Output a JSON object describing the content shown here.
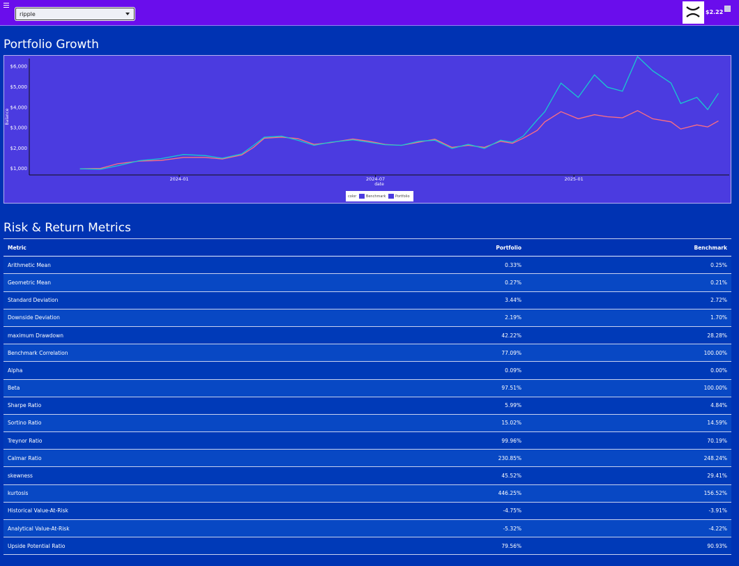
{
  "topbar": {
    "select_value": "ripple",
    "price": "$2.22",
    "colors": {
      "bar": "#6a0dec",
      "page": "#0033b3"
    }
  },
  "growth": {
    "title": "Portfolio Growth"
  },
  "chart_data": {
    "type": "line",
    "xlabel": "date",
    "ylabel": "Balance",
    "x_ticks": [
      "2024-01",
      "2024-07",
      "2025-01"
    ],
    "y_ticks": [
      "$1,000",
      "$2,000",
      "$3,000",
      "$4,000",
      "$5,000",
      "$6,000"
    ],
    "ylim": [
      700,
      6400
    ],
    "xlim": [
      "2023-08-15",
      "2025-05-25"
    ],
    "legend": {
      "title": "color",
      "position": "bottom-center"
    },
    "series": [
      {
        "name": "Benchmark",
        "color": "#ff6f7f",
        "points": [
          [
            "2023-10-01",
            1000
          ],
          [
            "2023-10-20",
            1020
          ],
          [
            "2023-11-05",
            1250
          ],
          [
            "2023-11-25",
            1380
          ],
          [
            "2023-12-15",
            1410
          ],
          [
            "2024-01-05",
            1560
          ],
          [
            "2024-01-25",
            1560
          ],
          [
            "2024-02-10",
            1480
          ],
          [
            "2024-02-28",
            1680
          ],
          [
            "2024-03-10",
            2050
          ],
          [
            "2024-03-20",
            2500
          ],
          [
            "2024-04-05",
            2550
          ],
          [
            "2024-04-20",
            2480
          ],
          [
            "2024-05-05",
            2200
          ],
          [
            "2024-05-20",
            2280
          ],
          [
            "2024-06-10",
            2460
          ],
          [
            "2024-06-25",
            2350
          ],
          [
            "2024-07-10",
            2200
          ],
          [
            "2024-07-25",
            2150
          ],
          [
            "2024-08-10",
            2300
          ],
          [
            "2024-08-25",
            2450
          ],
          [
            "2024-09-10",
            2050
          ],
          [
            "2024-09-25",
            2150
          ],
          [
            "2024-10-10",
            2050
          ],
          [
            "2024-10-25",
            2350
          ],
          [
            "2024-11-05",
            2250
          ],
          [
            "2024-11-15",
            2500
          ],
          [
            "2024-11-28",
            2880
          ],
          [
            "2024-12-05",
            3300
          ],
          [
            "2024-12-20",
            3800
          ],
          [
            "2025-01-05",
            3450
          ],
          [
            "2025-01-20",
            3650
          ],
          [
            "2025-02-01",
            3550
          ],
          [
            "2025-02-15",
            3500
          ],
          [
            "2025-03-01",
            3850
          ],
          [
            "2025-03-15",
            3450
          ],
          [
            "2025-04-01",
            3300
          ],
          [
            "2025-04-10",
            2950
          ],
          [
            "2025-04-25",
            3150
          ],
          [
            "2025-05-05",
            3050
          ],
          [
            "2025-05-15",
            3350
          ]
        ]
      },
      {
        "name": "Portfolio",
        "color": "#19c9cf",
        "points": [
          [
            "2023-10-01",
            1000
          ],
          [
            "2023-10-20",
            980
          ],
          [
            "2023-11-05",
            1150
          ],
          [
            "2023-11-25",
            1400
          ],
          [
            "2023-12-15",
            1500
          ],
          [
            "2024-01-05",
            1700
          ],
          [
            "2024-01-25",
            1650
          ],
          [
            "2024-02-10",
            1520
          ],
          [
            "2024-02-28",
            1730
          ],
          [
            "2024-03-10",
            2150
          ],
          [
            "2024-03-20",
            2550
          ],
          [
            "2024-04-05",
            2600
          ],
          [
            "2024-04-20",
            2400
          ],
          [
            "2024-05-05",
            2150
          ],
          [
            "2024-05-20",
            2300
          ],
          [
            "2024-06-10",
            2420
          ],
          [
            "2024-06-25",
            2300
          ],
          [
            "2024-07-10",
            2180
          ],
          [
            "2024-07-25",
            2150
          ],
          [
            "2024-08-10",
            2350
          ],
          [
            "2024-08-25",
            2400
          ],
          [
            "2024-09-10",
            2000
          ],
          [
            "2024-09-25",
            2200
          ],
          [
            "2024-10-10",
            2000
          ],
          [
            "2024-10-25",
            2400
          ],
          [
            "2024-11-05",
            2300
          ],
          [
            "2024-11-15",
            2600
          ],
          [
            "2024-11-28",
            3400
          ],
          [
            "2024-12-05",
            3800
          ],
          [
            "2024-12-20",
            5200
          ],
          [
            "2025-01-05",
            4500
          ],
          [
            "2025-01-20",
            5600
          ],
          [
            "2025-02-01",
            5000
          ],
          [
            "2025-02-15",
            4800
          ],
          [
            "2025-03-01",
            6500
          ],
          [
            "2025-03-15",
            5800
          ],
          [
            "2025-04-01",
            5200
          ],
          [
            "2025-04-10",
            4200
          ],
          [
            "2025-04-25",
            4500
          ],
          [
            "2025-05-05",
            3900
          ],
          [
            "2025-05-15",
            4700
          ]
        ]
      }
    ]
  },
  "metrics": {
    "title": "Risk & Return Metrics",
    "headers": [
      "Metric",
      "Portfolio",
      "Benchmark"
    ],
    "rows": [
      [
        "Arithmetic Mean",
        "0.33%",
        "0.25%"
      ],
      [
        "Geometric Mean",
        "0.27%",
        "0.21%"
      ],
      [
        "Standard Deviation",
        "3.44%",
        "2.72%"
      ],
      [
        "Downside Deviation",
        "2.19%",
        "1.70%"
      ],
      [
        "maximum Drawdown",
        "42.22%",
        "28.28%"
      ],
      [
        "Benchmark Correlation",
        "77.09%",
        "100.00%"
      ],
      [
        "Alpha",
        "0.09%",
        "0.00%"
      ],
      [
        "Beta",
        "97.51%",
        "100.00%"
      ],
      [
        "Sharpe Ratio",
        "5.99%",
        "4.84%"
      ],
      [
        "Sortino Ratio",
        "15.02%",
        "14.59%"
      ],
      [
        "Treynor Ratio",
        "99.96%",
        "70.19%"
      ],
      [
        "Calmar Ratio",
        "230.85%",
        "248.24%"
      ],
      [
        "skewness",
        "45.52%",
        "29.41%"
      ],
      [
        "kurtosis",
        "446.25%",
        "156.52%"
      ],
      [
        "Historical Value-At-Risk",
        "-4.75%",
        "-3.91%"
      ],
      [
        "Analytical Value-At-Risk",
        "-5.32%",
        "-4.22%"
      ],
      [
        "Upside Potential Ratio",
        "79.56%",
        "90.93%"
      ]
    ]
  }
}
